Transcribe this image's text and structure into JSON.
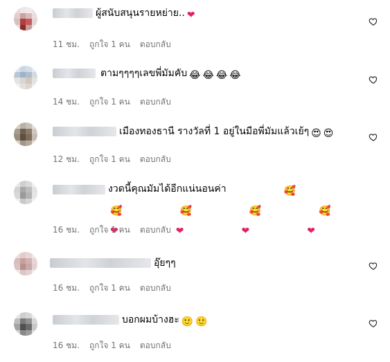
{
  "comments": [
    {
      "text": "ผู้สนับสนุนรายหย่าย..",
      "emojis": [
        "❤"
      ],
      "time": "11 ชม.",
      "likes": "ถูกใจ 1 คน",
      "reply": "ตอบกลับ"
    },
    {
      "text": "ตามๆๆๆๆเลขพี่มัมคับ",
      "emojis": [
        "😂",
        "😂",
        "😂",
        "😂"
      ],
      "time": "14 ชม.",
      "likes": "ถูกใจ 1 คน",
      "reply": "ตอบกลับ"
    },
    {
      "text": "เมืองทองธานี รางวัลที่ 1 อยู่ในมือพี่มัมแล้วเย้ๆ",
      "emojis": [
        "😍",
        "😍"
      ],
      "time": "12 ชม.",
      "likes": "ถูกใจ 1 คน",
      "reply": "ตอบกลับ"
    },
    {
      "text": "งวดนี้คุณมัมได้อีกแน่นอนค่า",
      "emojis": [
        "🥰",
        "🥰",
        "🥰",
        "🥰",
        "🥰",
        "❤",
        "❤",
        "❤",
        "❤"
      ],
      "time": "16 ชม.",
      "likes": "ถูกใจ 1 คน",
      "reply": "ตอบกลับ"
    },
    {
      "text": "อุ๊ยๆๆ",
      "emojis": [],
      "time": "16 ชม.",
      "likes": "ถูกใจ 1 คน",
      "reply": "ตอบกลับ"
    },
    {
      "text": "บอกผมบ้างฮะ",
      "emojis": [
        "🙂",
        "🙂"
      ],
      "time": "16 ชม.",
      "likes": "ถูกใจ 1 คน",
      "reply": "ตอบกลับ"
    }
  ],
  "icons": {
    "like": "heart-outline-icon"
  },
  "colors": {
    "meta": "#737373",
    "heart": "#e0245e",
    "emoji_face": "#f7c948"
  }
}
